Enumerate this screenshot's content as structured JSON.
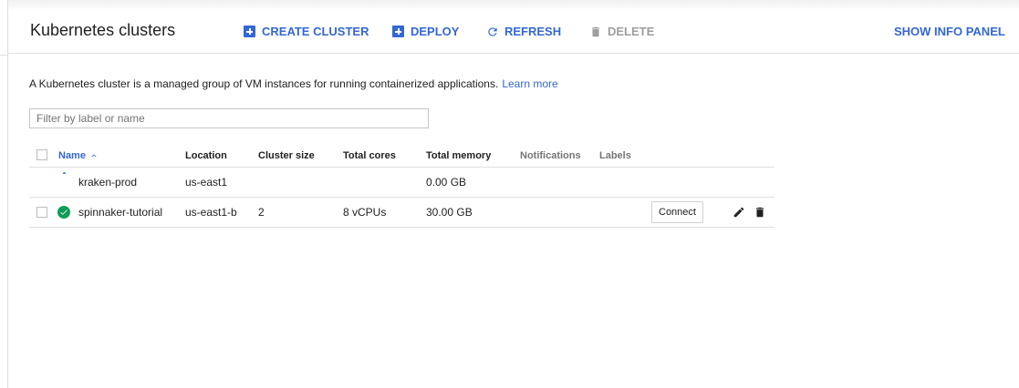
{
  "header": {
    "title": "Kubernetes clusters",
    "toolbar": {
      "create": "CREATE CLUSTER",
      "deploy": "DEPLOY",
      "refresh": "REFRESH",
      "delete": "DELETE",
      "info_panel": "SHOW INFO PANEL"
    }
  },
  "intro": {
    "text": "A Kubernetes cluster is a managed group of VM instances for running containerized applications.",
    "learn_more": "Learn more"
  },
  "filter": {
    "placeholder": "Filter by label or name",
    "value": ""
  },
  "table": {
    "columns": {
      "name": "Name",
      "location": "Location",
      "size": "Cluster size",
      "cores": "Total cores",
      "memory": "Total memory",
      "notifications": "Notifications",
      "labels": "Labels"
    },
    "rows": [
      {
        "status": "provisioning",
        "name": "kraken-prod",
        "location": "us-east1",
        "size": "",
        "cores": "",
        "memory": "0.00 GB"
      },
      {
        "status": "running",
        "name": "spinnaker-tutorial",
        "location": "us-east1-b",
        "size": "2",
        "cores": "8 vCPUs",
        "memory": "30.00 GB",
        "action": "Connect"
      }
    ]
  },
  "icons": {
    "create": "add-box-icon",
    "deploy": "add-box-icon",
    "refresh": "refresh-icon",
    "delete": "trash-icon",
    "sort": "arrow-up-icon",
    "status_running": "check-circle-icon",
    "status_provisioning": "spinner-icon",
    "edit": "pencil-icon",
    "row_delete": "trash-icon"
  },
  "colors": {
    "accent": "#3367d6",
    "disabled": "#9e9e9e",
    "success": "#0f9d58",
    "divider": "#e0e0e0"
  }
}
